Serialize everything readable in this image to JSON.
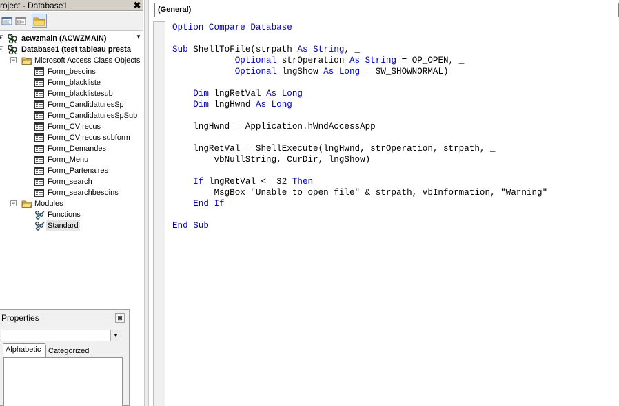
{
  "project_explorer": {
    "title": "roject - Database1",
    "close_glyph": "✖",
    "tree": {
      "project1": {
        "label": "acwzmain (ACWZMAIN)",
        "expander": "+"
      },
      "project2": {
        "label": "Database1 (test tableau presta",
        "expander": "−"
      },
      "folder_class_objects": {
        "label": "Microsoft Access Class Objects",
        "expander": "−"
      },
      "forms": [
        "Form_besoins",
        "Form_blackliste",
        "Form_blacklistesub",
        "Form_CandidaturesSp",
        "Form_CandidaturesSpSub",
        "Form_CV recus",
        "Form_CV recus subform",
        "Form_Demandes",
        "Form_Menu",
        "Form_Partenaires",
        "Form_search",
        "Form_searchbesoins"
      ],
      "folder_modules": {
        "label": "Modules",
        "expander": "−"
      },
      "modules": [
        "Functions",
        "Standard"
      ]
    }
  },
  "properties": {
    "title": "Properties",
    "close_glyph": "⊠",
    "dropdown_value": "",
    "tabs": [
      "Alphabetic",
      "Categorized"
    ]
  },
  "code_window": {
    "object_combo": "(General)",
    "lines": [
      [
        {
          "t": "Option Compare Database",
          "k": true
        }
      ],
      [
        {
          "t": "",
          "k": false
        }
      ],
      [
        {
          "t": "Sub",
          "k": true
        },
        {
          "t": " ShellToFile(strpath ",
          "k": false
        },
        {
          "t": "As String",
          "k": true
        },
        {
          "t": ", _",
          "k": false
        }
      ],
      [
        {
          "t": "            ",
          "k": false
        },
        {
          "t": "Optional",
          "k": true
        },
        {
          "t": " strOperation ",
          "k": false
        },
        {
          "t": "As String",
          "k": true
        },
        {
          "t": " = OP_OPEN, _",
          "k": false
        }
      ],
      [
        {
          "t": "            ",
          "k": false
        },
        {
          "t": "Optional",
          "k": true
        },
        {
          "t": " lngShow ",
          "k": false
        },
        {
          "t": "As Long",
          "k": true
        },
        {
          "t": " = SW_SHOWNORMAL)",
          "k": false
        }
      ],
      [
        {
          "t": "",
          "k": false
        }
      ],
      [
        {
          "t": "    ",
          "k": false
        },
        {
          "t": "Dim",
          "k": true
        },
        {
          "t": " lngRetVal ",
          "k": false
        },
        {
          "t": "As Long",
          "k": true
        }
      ],
      [
        {
          "t": "    ",
          "k": false
        },
        {
          "t": "Dim",
          "k": true
        },
        {
          "t": " lngHwnd ",
          "k": false
        },
        {
          "t": "As Long",
          "k": true
        }
      ],
      [
        {
          "t": "",
          "k": false
        }
      ],
      [
        {
          "t": "    lngHwnd = Application.hWndAccessApp",
          "k": false
        }
      ],
      [
        {
          "t": "",
          "k": false
        }
      ],
      [
        {
          "t": "    lngRetVal = ShellExecute(lngHwnd, strOperation, strpath, _",
          "k": false
        }
      ],
      [
        {
          "t": "        vbNullString, CurDir, lngShow)",
          "k": false
        }
      ],
      [
        {
          "t": "",
          "k": false
        }
      ],
      [
        {
          "t": "    ",
          "k": false
        },
        {
          "t": "If",
          "k": true
        },
        {
          "t": " lngRetVal <= 32 ",
          "k": false
        },
        {
          "t": "Then",
          "k": true
        }
      ],
      [
        {
          "t": "        MsgBox \"Unable to open file\" & strpath, vbInformation, \"Warning\"",
          "k": false
        }
      ],
      [
        {
          "t": "    ",
          "k": false
        },
        {
          "t": "End If",
          "k": true
        }
      ],
      [
        {
          "t": "",
          "k": false
        }
      ],
      [
        {
          "t": "End Sub",
          "k": true
        }
      ]
    ]
  },
  "colors": {
    "keyword": "#0000cc",
    "panel_bg": "#f0f0f0",
    "folder_yellow": "#f3d27a"
  },
  "icons": [
    "project-icon",
    "folder-icon",
    "form-module-icon",
    "standard-module-icon"
  ]
}
